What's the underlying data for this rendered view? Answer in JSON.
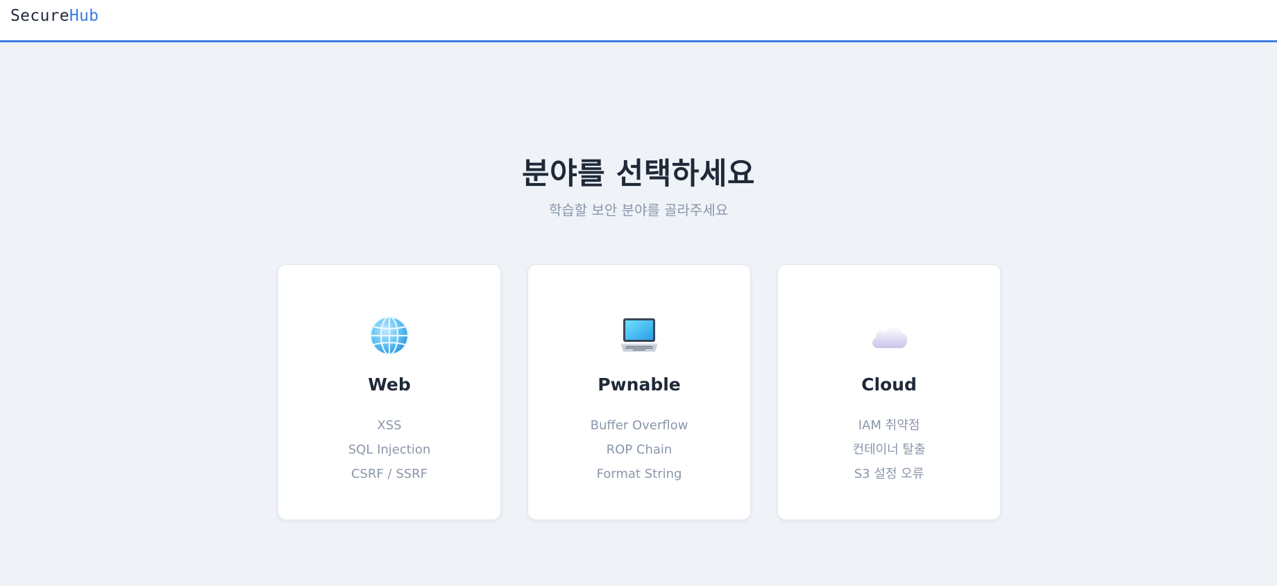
{
  "header": {
    "logo_part1": "Secure",
    "logo_part2": "Hub"
  },
  "main": {
    "title": "분야를 선택하세요",
    "subtitle": "학습할 보안 분야를 골라주세요"
  },
  "cards": [
    {
      "icon": "globe-icon",
      "title": "Web",
      "items": [
        "XSS",
        "SQL Injection",
        "CSRF / SSRF"
      ]
    },
    {
      "icon": "laptop-icon",
      "title": "Pwnable",
      "items": [
        "Buffer Overflow",
        "ROP Chain",
        "Format String"
      ]
    },
    {
      "icon": "cloud-icon",
      "title": "Cloud",
      "items": [
        "IAM 취약점",
        "컨테이너 탈출",
        "S3 설정 오류"
      ]
    }
  ],
  "colors": {
    "accent": "#3b7de0",
    "background": "#eff3f8",
    "text_dark": "#1f2937",
    "text_muted": "#8a96a8"
  }
}
